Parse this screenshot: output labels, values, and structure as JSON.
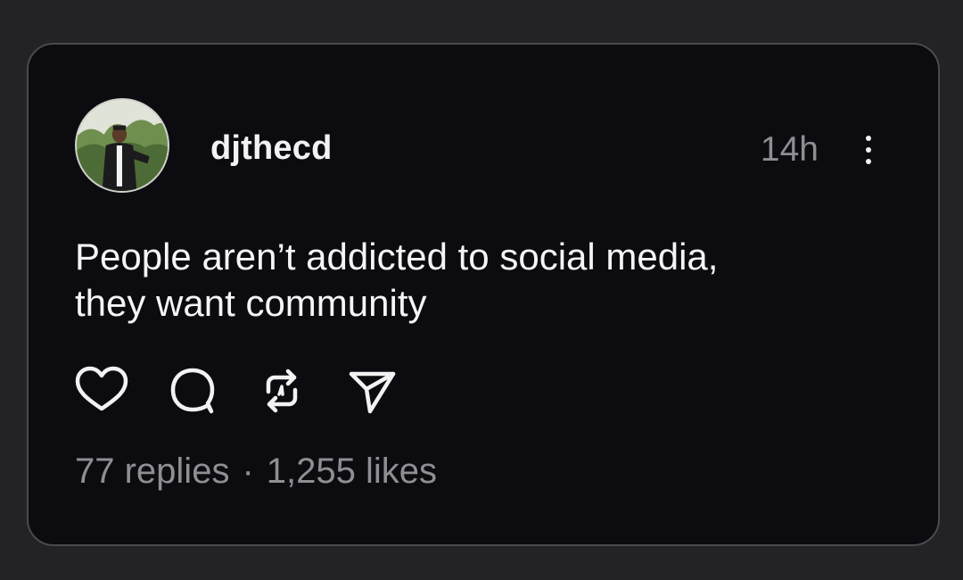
{
  "post": {
    "username": "djthecd",
    "time": "14h",
    "text_lines": [
      "People aren’t addicted to social media,",
      "they want community"
    ],
    "replies": "77 replies",
    "separator": "·",
    "likes": "1,255 likes"
  },
  "icons": {
    "more": "more-vertical-icon",
    "like": "heart-icon",
    "reply": "comment-bubble-icon",
    "repost": "repost-icon",
    "share": "send-icon"
  },
  "colors": {
    "page_background": "#232326",
    "card_background": "#0c0b10",
    "card_border": "#4a494f",
    "primary_text": "#f2f2f2",
    "secondary_text": "#8e8e93"
  }
}
